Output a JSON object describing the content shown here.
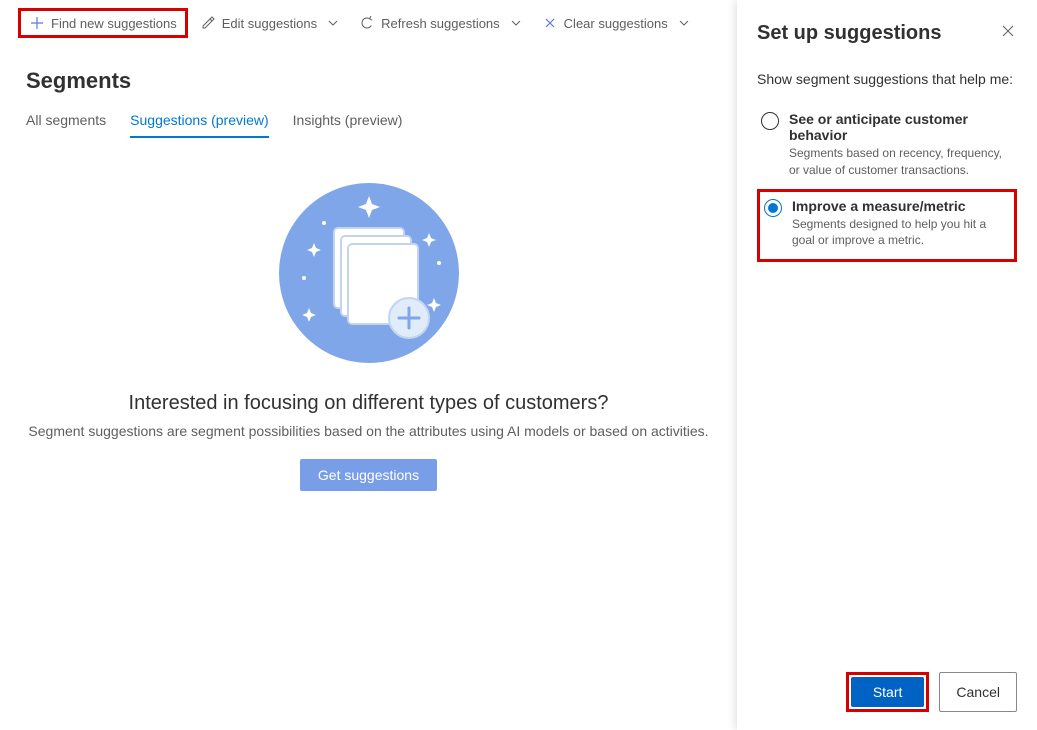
{
  "toolbar": {
    "find": "Find new suggestions",
    "edit": "Edit suggestions",
    "refresh": "Refresh suggestions",
    "clear": "Clear suggestions"
  },
  "page": {
    "title": "Segments"
  },
  "tabs": {
    "all": "All segments",
    "suggestions": "Suggestions (preview)",
    "insights": "Insights (preview)"
  },
  "empty": {
    "title": "Interested in focusing on different types of customers?",
    "subtitle": "Segment suggestions are segment possibilities based on the attributes using AI models or based on activities.",
    "button": "Get suggestions"
  },
  "panel": {
    "title": "Set up suggestions",
    "intro": "Show segment suggestions that help me:",
    "option1": {
      "title": "See or anticipate customer behavior",
      "desc": "Segments based on recency, frequency, or value of customer transactions."
    },
    "option2": {
      "title": "Improve a measure/metric",
      "desc": "Segments designed to help you hit a goal or improve a metric."
    },
    "start": "Start",
    "cancel": "Cancel"
  }
}
